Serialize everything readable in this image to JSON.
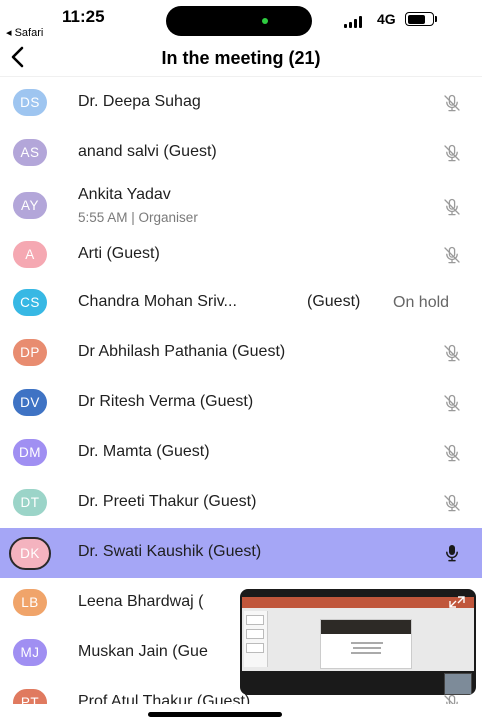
{
  "status_bar": {
    "time": "11:25",
    "back_app": "◂ Safari",
    "network": "4G"
  },
  "header": {
    "title": "In the meeting (21)"
  },
  "participants": [
    {
      "initials": "DS",
      "name": "Dr. Deepa Suhag",
      "color": "#9ec5f0",
      "mic": "muted"
    },
    {
      "initials": "AS",
      "name": "anand salvi (Guest)",
      "color": "#b3a6d9",
      "mic": "muted"
    },
    {
      "initials": "AY",
      "name": "Ankita Yadav",
      "subtitle": "5:55 AM | Organiser",
      "color": "#b3a6d9",
      "mic": "muted"
    },
    {
      "initials": "A",
      "name": "Arti  (Guest)",
      "color": "#f5a8b2",
      "mic": "muted"
    },
    {
      "initials": "CS",
      "name": "Chandra Mohan Sriv...",
      "guest": "(Guest)",
      "status": "On hold",
      "color": "#37b8e4",
      "mic": "none"
    },
    {
      "initials": "DP",
      "name": "Dr Abhilash Pathania (Guest)",
      "color": "#e88c70",
      "mic": "muted"
    },
    {
      "initials": "DV",
      "name": "Dr Ritesh Verma (Guest)",
      "color": "#3f73c4",
      "mic": "muted"
    },
    {
      "initials": "DM",
      "name": "Dr. Mamta (Guest)",
      "color": "#a08ff2",
      "mic": "muted"
    },
    {
      "initials": "DT",
      "name": "Dr. Preeti Thakur (Guest)",
      "color": "#9bd4c8",
      "mic": "muted"
    },
    {
      "initials": "DK",
      "name": "Dr. Swati Kaushik (Guest)",
      "color": "#f4b3bf",
      "mic": "active"
    },
    {
      "initials": "LB",
      "name": "Leena Bhardwaj (",
      "color": "#f0a46a",
      "mic": "hidden"
    },
    {
      "initials": "MJ",
      "name": "Muskan Jain (Gue",
      "color": "#a08ff2",
      "mic": "hidden"
    },
    {
      "initials": "PT",
      "name": "Prof Atul Thakur (Guest)",
      "color": "#e07a5f",
      "mic": "muted"
    }
  ],
  "colors": {
    "active_row": "#a5a6f6",
    "muted_mic": "#9a9a9a",
    "active_mic": "#1a1a1a"
  }
}
